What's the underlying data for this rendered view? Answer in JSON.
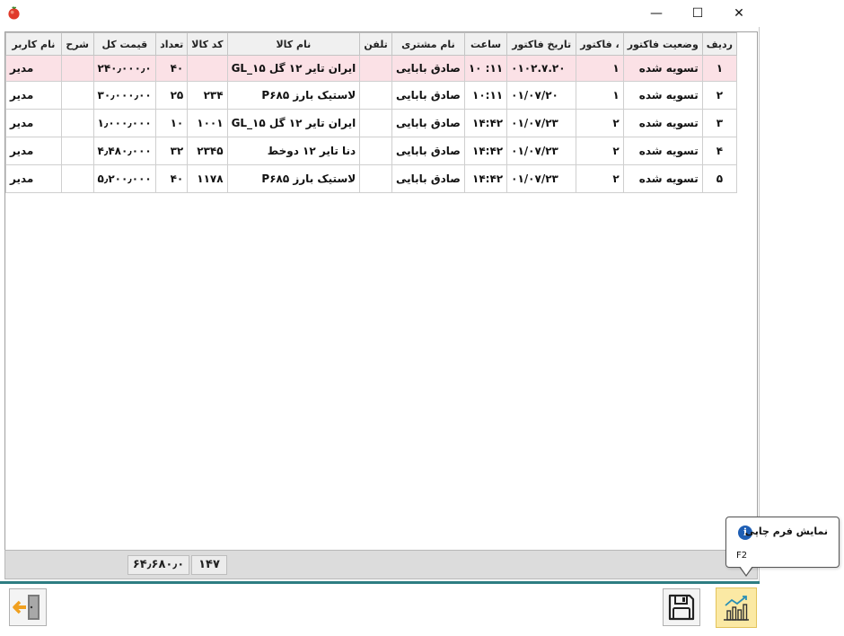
{
  "window": {
    "app_icon": "tomato-icon",
    "minimize_glyph": "—",
    "maximize_glyph": "☐",
    "close_glyph": "✕"
  },
  "grid": {
    "columns": [
      "ردیف",
      "وضعیت فاکتور",
      "، فاکتور",
      "تاریخ فاکتور",
      "ساعت",
      "نام مشتری",
      "تلفن",
      "نام کالا",
      "کد کالا",
      "تعداد",
      "قیمت کل",
      "شرح",
      "نام کاربر"
    ],
    "rows": [
      {
        "row": "۱",
        "status": "تسویه شده",
        "invoice": "۱",
        "date": "۰۱۰۲.۷.۲۰",
        "time": "۱۱: ۱۰",
        "customer": "صادق بابایی",
        "phone": "",
        "product": "ایران تایر ۱۲ گل GL_۱۵",
        "code": "",
        "qty": "۴۰",
        "total": "۲۴۰٫۰۰۰٫۰",
        "desc": "",
        "user": "مدیر"
      },
      {
        "row": "۲",
        "status": "تسویه شده",
        "invoice": "۱",
        "date": "۰۱/۰۷/۲۰",
        "time": "۱۰:۱۱",
        "customer": "صادق بابایی",
        "phone": "",
        "product": "لاستیک بارز P۶۸۵",
        "code": "۲۳۴",
        "qty": "۲۵",
        "total": "۳۰٫۰۰۰٫۰۰",
        "desc": "",
        "user": "مدیر"
      },
      {
        "row": "۳",
        "status": "تسویه شده",
        "invoice": "۲",
        "date": "۰۱/۰۷/۲۳",
        "time": "۱۴:۴۲",
        "customer": "صادق بابایی",
        "phone": "",
        "product": "ایران تایر ۱۲ گل GL_۱۵",
        "code": "۱۰۰۱",
        "qty": "۱۰",
        "total": "۱٫۰۰۰٫۰۰۰",
        "desc": "",
        "user": "مدیر"
      },
      {
        "row": "۴",
        "status": "تسویه شده",
        "invoice": "۲",
        "date": "۰۱/۰۷/۲۳",
        "time": "۱۴:۴۲",
        "customer": "صادق بابایی",
        "phone": "",
        "product": "دنا تایر ۱۲ دوخط",
        "code": "۲۳۴۵",
        "qty": "۳۲",
        "total": "۴٫۴۸۰٫۰۰۰",
        "desc": "",
        "user": "مدیر"
      },
      {
        "row": "۵",
        "status": "تسویه شده",
        "invoice": "۲",
        "date": "۰۱/۰۷/۲۳",
        "time": "۱۴:۴۲",
        "customer": "صادق بابایی",
        "phone": "",
        "product": "لاستیک بارز P۶۸۵",
        "code": "۱۱۷۸",
        "qty": "۴۰",
        "total": "۵٫۲۰۰٫۰۰۰",
        "desc": "",
        "user": "مدیر"
      }
    ]
  },
  "totals": {
    "qty_sum": "۱۴۷",
    "price_sum": "۶۴٫۶۸۰٫۰"
  },
  "toolbar": {
    "exit_icon": "exit-door-icon",
    "save_icon": "floppy-disk-icon",
    "chart_icon": "chart-print-icon"
  },
  "tooltip": {
    "title": "نمایش فرم چاپی",
    "shortcut": "F2",
    "icon": "info-icon"
  },
  "colors": {
    "selected_row": "#fbe1e6",
    "accent_line": "#2d7d82",
    "active_button": "#fbe9a4",
    "info_blue": "#1f5fb4"
  }
}
